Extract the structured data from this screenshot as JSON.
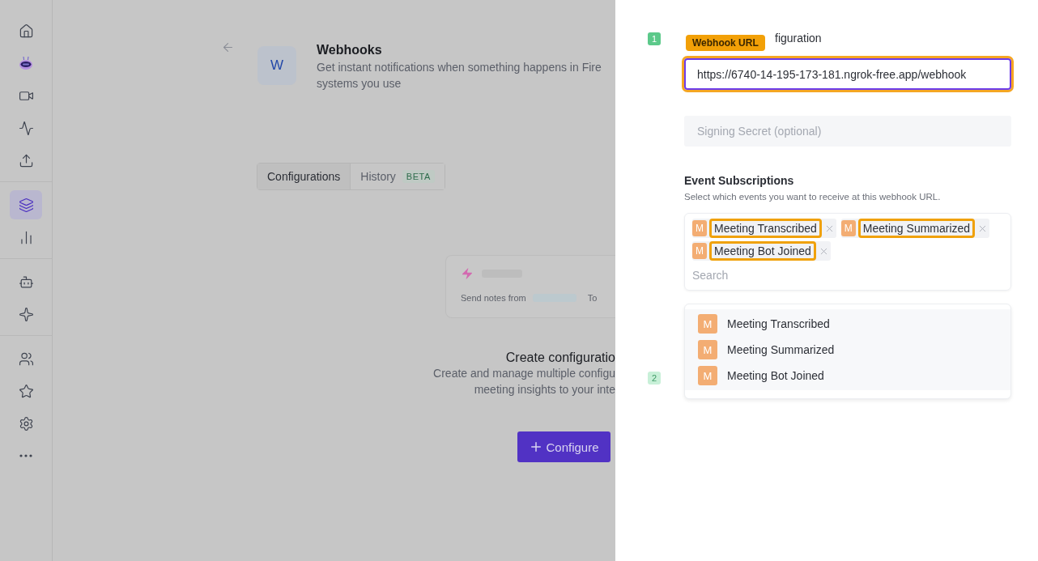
{
  "sidebar": {
    "groups": [
      {
        "items": [
          {
            "selected": false
          },
          {
            "selected": false
          },
          {
            "selected": false
          },
          {
            "selected": false
          },
          {
            "selected": false
          }
        ]
      },
      {
        "items": [
          {
            "selected": true
          },
          {
            "selected": false
          }
        ]
      },
      {
        "items": [
          {
            "selected": false
          },
          {
            "selected": false
          }
        ]
      },
      {
        "items": [
          {
            "selected": false
          },
          {
            "selected": false
          },
          {
            "selected": false
          },
          {
            "selected": false
          }
        ]
      }
    ]
  },
  "header": {
    "logo_letter": "W",
    "title": "Webhooks",
    "description": "Get instant notifications when something happens in Fire",
    "description_line_2": "systems you use"
  },
  "tabs": [
    {
      "label": "Configurations",
      "selected": true
    },
    {
      "label": "History",
      "badge": "BETA",
      "selected": false
    }
  ],
  "preview_card": {
    "text": "Send notes from",
    "to": "To"
  },
  "empty_state": {
    "title": "Create configuratio",
    "lines": [
      "Create and manage multiple configu",
      "meeting insights to your inte"
    ],
    "button": "Configure"
  },
  "panel": {
    "steps": [
      {
        "number": "1",
        "active": true
      },
      {
        "number": "2",
        "active": false
      }
    ],
    "section_title_visible": "figuration",
    "url_label": "Webhook URL",
    "url_value": "https://6740-14-195-173-181.ngrok-free.app/webhook",
    "secret_placeholder": "Signing Secret (optional)",
    "events_title": "Event Subscriptions",
    "events_description": "Select which events you want to receive at this webhook URL.",
    "chips": [
      {
        "letter": "M",
        "label": "Meeting Transcribed",
        "highlighted": true
      },
      {
        "letter": "M",
        "label": "Meeting Summarized",
        "highlighted": true
      },
      {
        "letter": "M",
        "label": "Meeting Bot Joined",
        "highlighted": true
      }
    ],
    "search_placeholder": "Search",
    "options": [
      {
        "letter": "M",
        "label": "Meeting Transcribed"
      },
      {
        "letter": "M",
        "label": "Meeting Summarized"
      },
      {
        "letter": "M",
        "label": "Meeting Bot Joined"
      }
    ]
  }
}
